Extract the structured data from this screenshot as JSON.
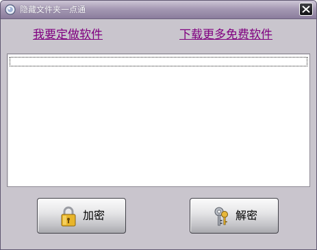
{
  "window": {
    "title": "隐藏文件夹一点通"
  },
  "links": {
    "custom_software": "我要定做软件",
    "free_download": "下载更多免费软件"
  },
  "list": {
    "rows": [
      ""
    ]
  },
  "buttons": {
    "encrypt_label": "加密",
    "decrypt_label": "解密"
  },
  "icons": {
    "app": "app-globe-icon",
    "close": "close-icon",
    "encrypt": "padlock-icon",
    "decrypt": "keys-icon"
  },
  "colors": {
    "link": "#800080",
    "window_bg": "#c9c5cd",
    "titlebar": "#8a7c9c"
  }
}
